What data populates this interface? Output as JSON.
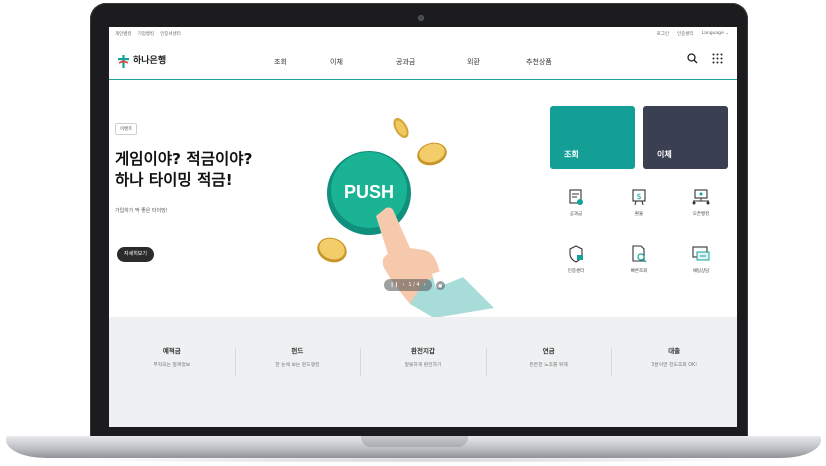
{
  "util_links_left": [
    "개인뱅킹",
    "기업뱅킹",
    "인증서센터"
  ],
  "util_links_right": [
    "로그인",
    "인증센터",
    "Language ⌄"
  ],
  "brand": {
    "name": "하나은행",
    "accent": "#12a39a"
  },
  "menu": [
    "조회",
    "이체",
    "공과금",
    "외환",
    "추천상품"
  ],
  "header_icons": [
    "search-icon",
    "grid-menu-icon"
  ],
  "hero": {
    "badge": "이벤트",
    "title": "게임이야? 적금이야?\n하나 타이밍 적금!",
    "subtitle": "가입하기 딱 좋은 타이밍!",
    "cta": "자세히보기",
    "push_label": "PUSH",
    "pager_text": "1 / 4"
  },
  "tiles": [
    {
      "label": "조회",
      "color": "#139f96"
    },
    {
      "label": "이체",
      "color": "#3b3f52"
    }
  ],
  "quick_menu": [
    {
      "label": "공과금",
      "icon": "bill-icon"
    },
    {
      "label": "환율",
      "icon": "exchange-rate-icon"
    },
    {
      "label": "오픈뱅킹",
      "icon": "open-banking-icon"
    },
    {
      "label": "인증센터",
      "icon": "shield-certificate-icon"
    },
    {
      "label": "빠른조회",
      "icon": "quick-search-icon"
    },
    {
      "label": "채팅상담",
      "icon": "chat-icon"
    }
  ],
  "categories": [
    {
      "title": "예적금",
      "desc": "부자되는 알짜정보"
    },
    {
      "title": "펀드",
      "desc": "한 눈에 보는 펀드랭킹"
    },
    {
      "title": "환전지갑",
      "desc": "알뜰하게 환전하기"
    },
    {
      "title": "연금",
      "desc": "든든한 노후를 위해"
    },
    {
      "title": "대출",
      "desc": "3분이면 한도조회 OK!"
    }
  ]
}
